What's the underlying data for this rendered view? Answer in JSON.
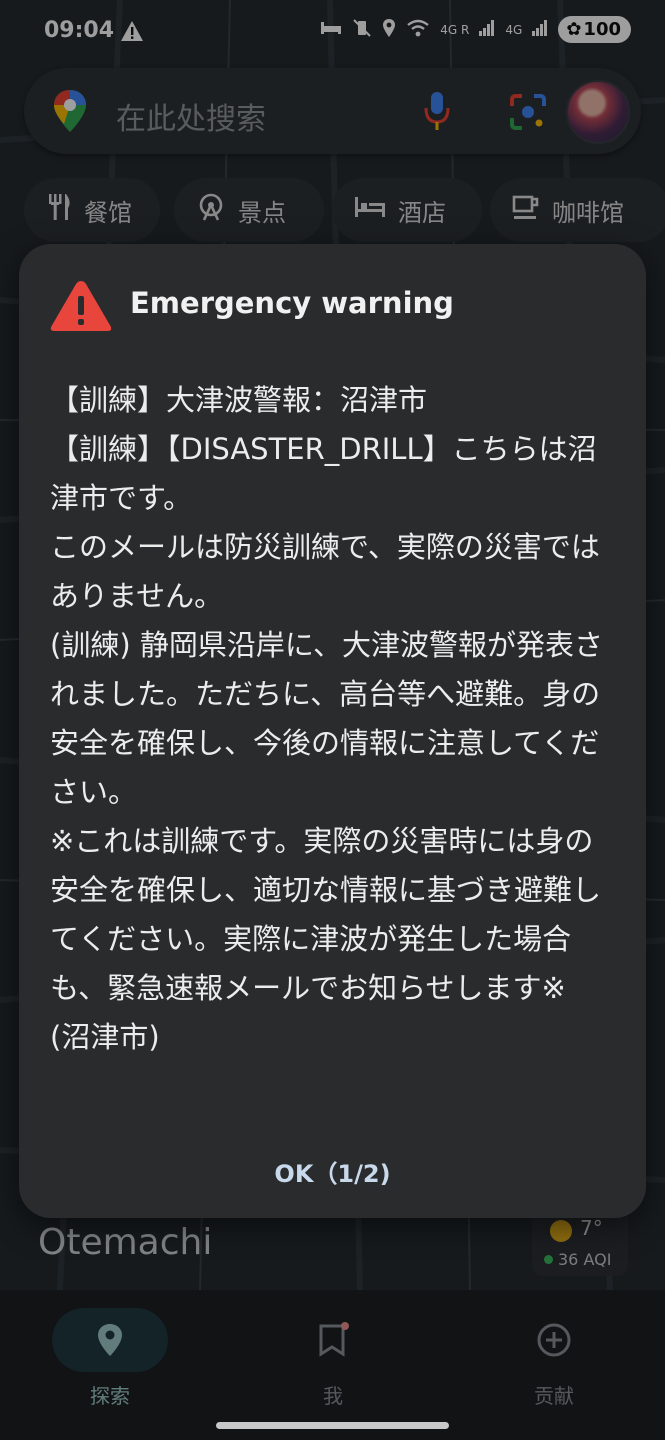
{
  "status_bar": {
    "time": "09:04",
    "network_labels": [
      "4G R",
      "4G"
    ],
    "battery": "100"
  },
  "search": {
    "placeholder": "在此处搜索",
    "icons": [
      "maps-pin-icon",
      "mic-icon",
      "lens-icon",
      "avatar"
    ]
  },
  "chips": [
    {
      "label": "餐馆",
      "icon": "restaurant-icon"
    },
    {
      "label": "景点",
      "icon": "attraction-icon"
    },
    {
      "label": "酒店",
      "icon": "hotel-icon"
    },
    {
      "label": "咖啡馆",
      "icon": "cafe-icon"
    }
  ],
  "dialog": {
    "title": "Emergency warning",
    "body": "【訓練】大津波警報：沼津市\n【訓練】【DISASTER_DRILL】こちらは沼津市です。\nこのメールは防災訓練で、実際の災害ではありません。\n(訓練) 静岡県沿岸に、大津波警報が発表されました。ただちに、高台等へ避難。身の安全を確保し、今後の情報に注意してください。\n※これは訓練です。実際の災害時には身の安全を確保し、適切な情報に基づき避難してください。実際に津波が発生した場合も、緊急速報メールでお知らせします※\n(沼津市)",
    "ok_label": "OK（1/2)"
  },
  "sheet": {
    "place_name": "Otemachi",
    "temperature": "7°",
    "aqi": "36 AQI"
  },
  "bottom_nav": [
    {
      "label": "探索",
      "active": true
    },
    {
      "label": "我",
      "active": false
    },
    {
      "label": "贡献",
      "active": false
    }
  ],
  "colors": {
    "warning_red": "#e8453c",
    "dialog_bg": "#2a2b2d",
    "ok_text": "#c9d9ec"
  }
}
